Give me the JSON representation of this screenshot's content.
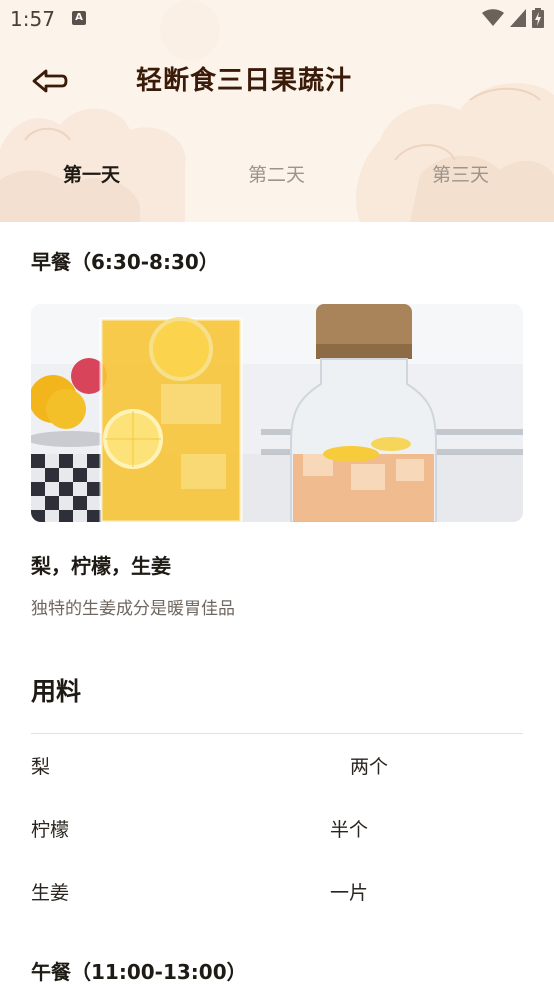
{
  "status_bar": {
    "time": "1:57",
    "notification_badge": "A",
    "icons": [
      "wifi-icon",
      "signal-icon",
      "battery-charging-icon"
    ]
  },
  "header": {
    "back_icon": "back-arrow-icon",
    "title": "轻断食三日果蔬汁"
  },
  "tabs": [
    {
      "label": "第一天",
      "active": true
    },
    {
      "label": "第二天",
      "active": false
    },
    {
      "label": "第三天",
      "active": false
    }
  ],
  "breakfast": {
    "title": "早餐（6:30-8:30）",
    "dish_name": "梨，柠檬，生姜",
    "dish_desc": "独特的生姜成分是暖胃佳品"
  },
  "ingredients": {
    "title": "用料",
    "items": [
      {
        "name": "梨",
        "amount": "两个"
      },
      {
        "name": "柠檬",
        "amount": "半个"
      },
      {
        "name": "生姜",
        "amount": "一片"
      }
    ]
  },
  "lunch": {
    "title": "午餐（11:00-13:00）"
  },
  "colors": {
    "header_bg": "#fcf3ea",
    "title": "#3a1a08",
    "active_tab": "#1e1a14",
    "inactive_tab": "#9c948d"
  }
}
